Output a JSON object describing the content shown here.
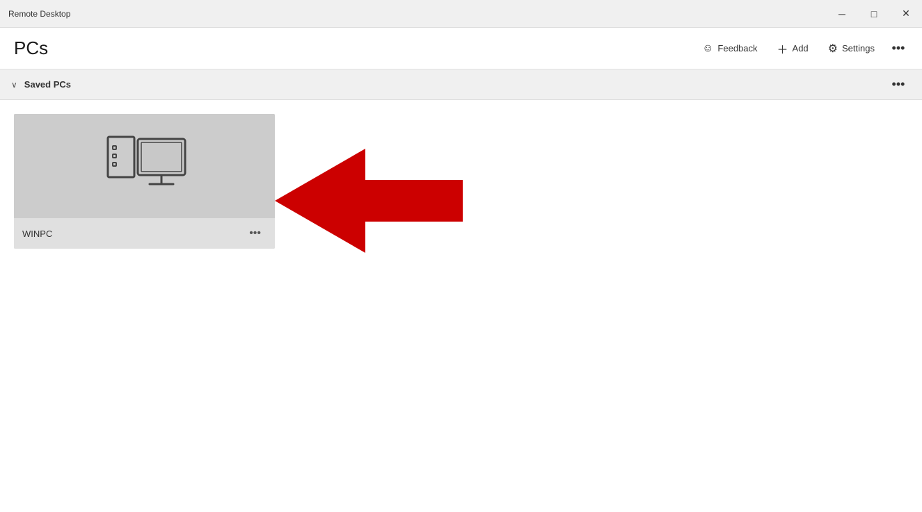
{
  "titlebar": {
    "title": "Remote Desktop",
    "min_label": "─",
    "max_label": "□",
    "close_label": "✕"
  },
  "header": {
    "page_title": "PCs",
    "feedback_label": "Feedback",
    "add_label": "Add",
    "settings_label": "Settings",
    "more_label": "•••"
  },
  "section": {
    "title": "Saved PCs",
    "chevron": "˅",
    "more_label": "•••"
  },
  "pc_card": {
    "name": "WINPC",
    "more_label": "•••"
  }
}
